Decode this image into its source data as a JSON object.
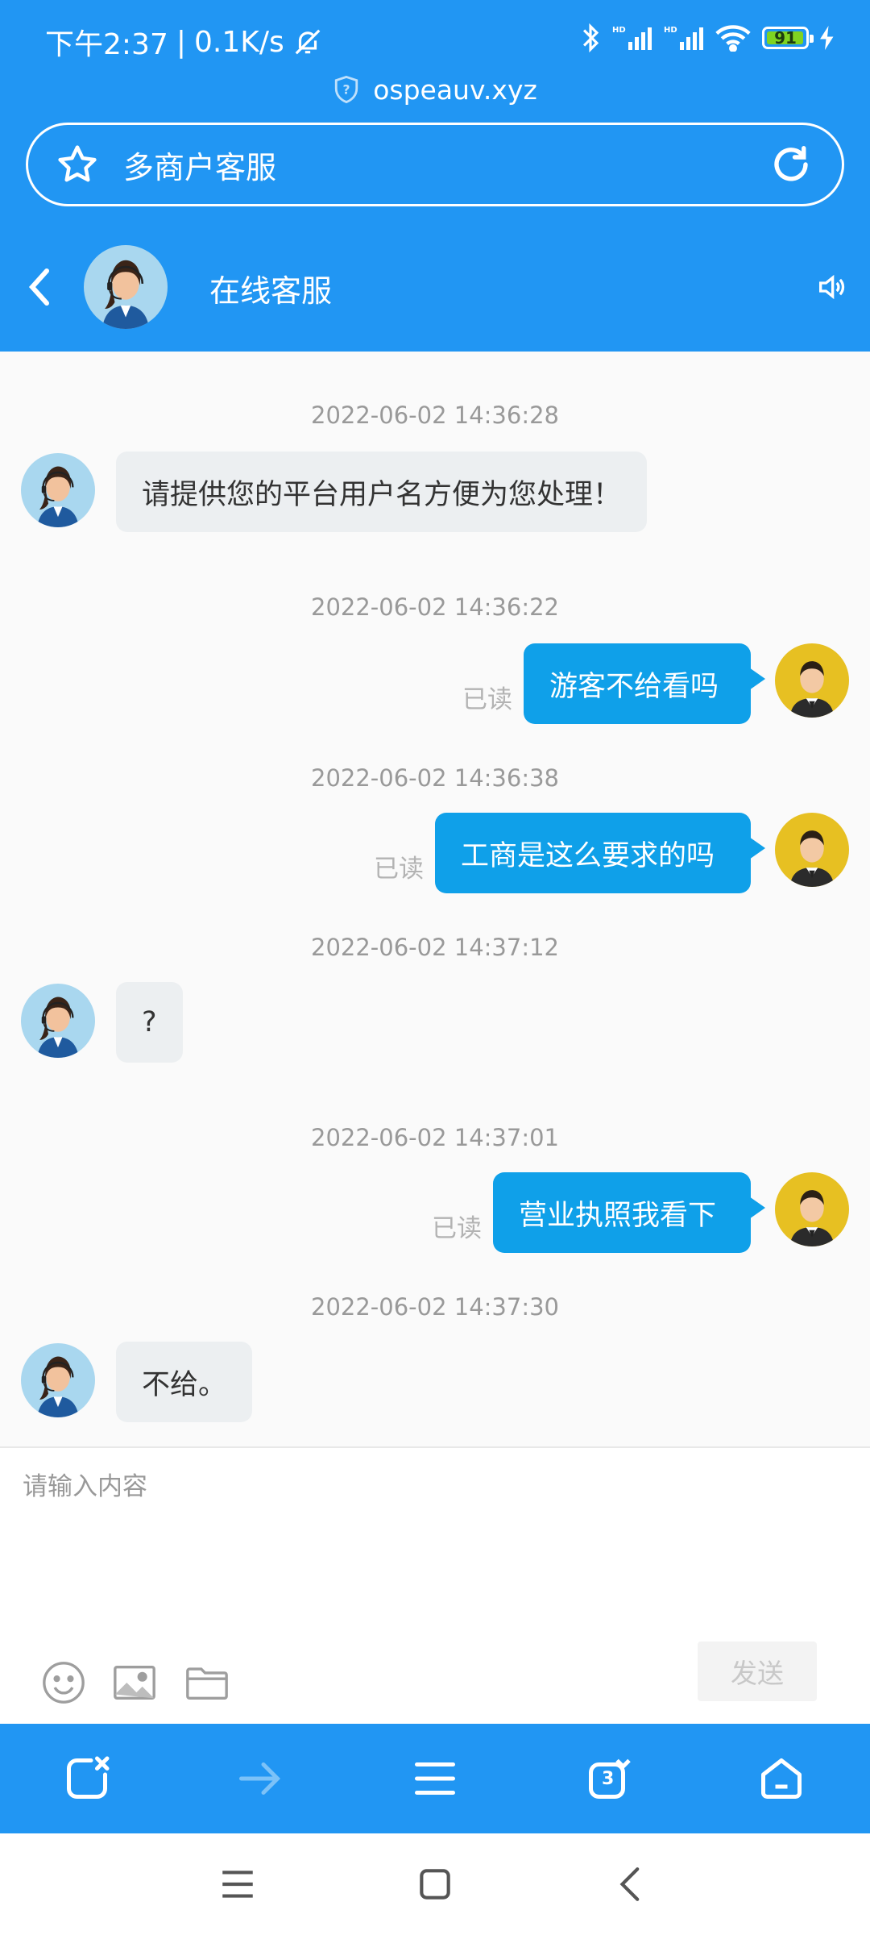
{
  "status_bar": {
    "time": "下午2:37",
    "speed": "0.1K/s",
    "battery": "91"
  },
  "browser": {
    "domain": "ospeauv.xyz",
    "page_title": "多商户客服"
  },
  "chat_header": {
    "title": "在线客服"
  },
  "messages": [
    {
      "timestamp": "2022-06-02 14:36:28",
      "sender": "agent",
      "text": "请提供您的平台用户名方便为您处理！",
      "read": ""
    },
    {
      "timestamp": "2022-06-02 14:36:22",
      "sender": "user",
      "text": "游客不给看吗",
      "read": "已读"
    },
    {
      "timestamp": "2022-06-02 14:36:38",
      "sender": "user",
      "text": "工商是这么要求的吗",
      "read": "已读"
    },
    {
      "timestamp": "2022-06-02 14:37:12",
      "sender": "agent",
      "text": "?",
      "read": ""
    },
    {
      "timestamp": "2022-06-02 14:37:01",
      "sender": "user",
      "text": "营业执照我看下",
      "read": "已读"
    },
    {
      "timestamp": "2022-06-02 14:37:30",
      "sender": "agent",
      "text": "不给。",
      "read": ""
    }
  ],
  "input": {
    "placeholder": "请输入内容",
    "value": "",
    "send_label": "发送"
  },
  "browser_toolbar": {
    "tab_count": "3"
  },
  "colors": {
    "primary": "#2196f3",
    "user_bubble": "#0fa0e9",
    "agent_bubble": "#eceff1",
    "battery": "#7fd321"
  }
}
